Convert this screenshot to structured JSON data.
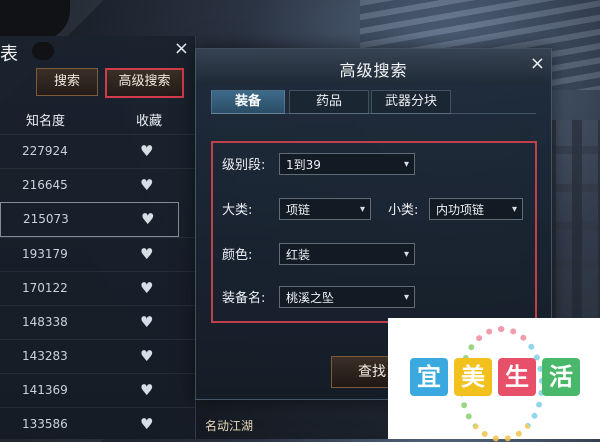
{
  "list_window": {
    "title": "表",
    "close": "×",
    "search_button": "搜索",
    "advanced_button": "高级搜索",
    "col_fame": "知名度",
    "col_favorite": "收藏",
    "rows": [
      {
        "fame": "227924"
      },
      {
        "fame": "216645"
      },
      {
        "fame": "215073"
      },
      {
        "fame": "193179"
      },
      {
        "fame": "170122"
      },
      {
        "fame": "148338"
      },
      {
        "fame": "143283"
      },
      {
        "fame": "141369"
      },
      {
        "fame": "133586"
      }
    ]
  },
  "dialog": {
    "title": "高级搜索",
    "close": "×",
    "tabs": [
      "装备",
      "药品",
      "武器分块"
    ],
    "active_tab": 0,
    "fields": {
      "level_label": "级别段:",
      "level_value": "1到39",
      "major_label": "大类:",
      "major_value": "项链",
      "minor_label": "小类:",
      "minor_value": "内功项链",
      "color_label": "颜色:",
      "color_value": "红装",
      "name_label": "装备名:",
      "name_value": "桃溪之坠"
    },
    "find_button": "查找"
  },
  "bottom_label": "名动江湖",
  "watermark": [
    "宜",
    "美",
    "生",
    "活"
  ],
  "icons": {
    "chevron": "▾",
    "heart": "♥",
    "close": "×"
  },
  "colors": {
    "highlight": "#c0404c",
    "tab_active": "#3d6a8a"
  }
}
